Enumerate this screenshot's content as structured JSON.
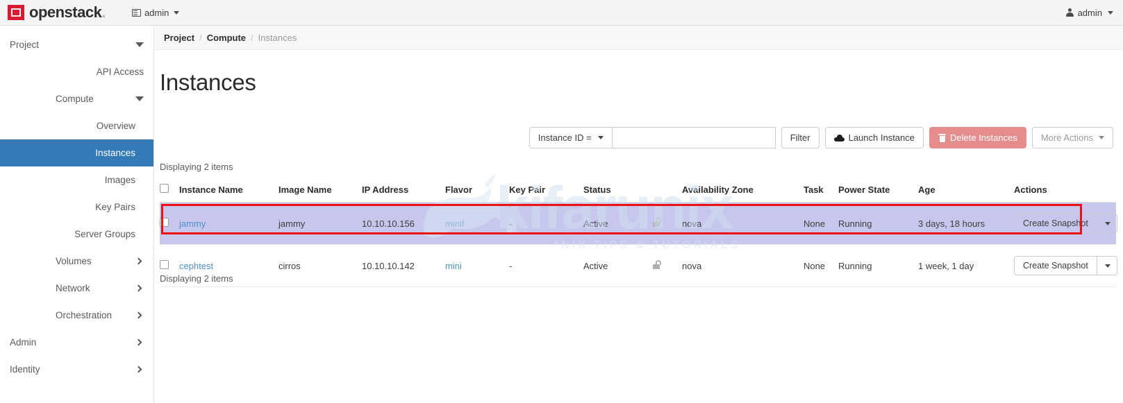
{
  "header": {
    "brand": "openstack",
    "brand_dot": ".",
    "context_label": "admin",
    "context_icon": "panel-icon",
    "user_label": "admin",
    "user_icon": "person-icon"
  },
  "sidebar": {
    "items": [
      {
        "label": "Project",
        "level": 0,
        "icon": "chevron-down-icon",
        "active": false
      },
      {
        "label": "API Access",
        "level": 1,
        "icon": "",
        "active": false
      },
      {
        "label": "Compute",
        "level": 1,
        "icon": "chevron-down-icon",
        "active": false
      },
      {
        "label": "Overview",
        "level": 2,
        "icon": "",
        "active": false
      },
      {
        "label": "Instances",
        "level": 2,
        "icon": "",
        "active": true
      },
      {
        "label": "Images",
        "level": 2,
        "icon": "",
        "active": false
      },
      {
        "label": "Key Pairs",
        "level": 2,
        "icon": "",
        "active": false
      },
      {
        "label": "Server Groups",
        "level": 2,
        "icon": "",
        "active": false
      },
      {
        "label": "Volumes",
        "level": 1,
        "icon": "chevron-right-icon",
        "active": false
      },
      {
        "label": "Network",
        "level": 1,
        "icon": "chevron-right-icon",
        "active": false
      },
      {
        "label": "Orchestration",
        "level": 1,
        "icon": "chevron-right-icon",
        "active": false
      },
      {
        "label": "Admin",
        "level": 0,
        "icon": "chevron-right-icon",
        "active": false
      },
      {
        "label": "Identity",
        "level": 0,
        "icon": "chevron-right-icon",
        "active": false
      }
    ]
  },
  "breadcrumb": {
    "items": [
      "Project",
      "Compute",
      "Instances"
    ],
    "separator": "/"
  },
  "page": {
    "title": "Instances",
    "count_top": "Displaying 2 items",
    "count_bottom": "Displaying 2 items"
  },
  "toolbar": {
    "filter_select_label": "Instance ID =",
    "filter_input_value": "",
    "filter_input_placeholder": "",
    "filter_button": "Filter",
    "launch_button": "Launch Instance",
    "delete_button": "Delete Instances",
    "more_actions_button": "More Actions"
  },
  "table": {
    "columns": [
      "Instance Name",
      "Image Name",
      "IP Address",
      "Flavor",
      "Key Pair",
      "Status",
      "Availability Zone",
      "Task",
      "Power State",
      "Age",
      "Actions"
    ],
    "rows": [
      {
        "name": "jammy",
        "image": "jammy",
        "ip": "10.10.10.156",
        "flavor": "minif",
        "key_pair": "-",
        "status": "Active",
        "lock": "unlock-icon",
        "az": "nova",
        "task": "None",
        "power": "Running",
        "age": "3 days, 18 hours",
        "action": "Create Snapshot",
        "highlighted": true
      },
      {
        "name": "cephtest",
        "image": "cirros",
        "ip": "10.10.10.142",
        "flavor": "mini",
        "key_pair": "-",
        "status": "Active",
        "lock": "unlock-icon",
        "az": "nova",
        "task": "None",
        "power": "Running",
        "age": "1 week, 1 day",
        "action": "Create Snapshot",
        "highlighted": false
      }
    ]
  },
  "watermark": {
    "text": "kifarunix",
    "subtitle": "*NIX TIPS & TUTORIALS"
  },
  "colors": {
    "brand_red": "#da1a32",
    "active_nav": "#337ab7",
    "link": "#4d8fca",
    "danger": "#e58c8c",
    "annotation": "#ee1111",
    "row_highlight": "#c7c7ed"
  }
}
